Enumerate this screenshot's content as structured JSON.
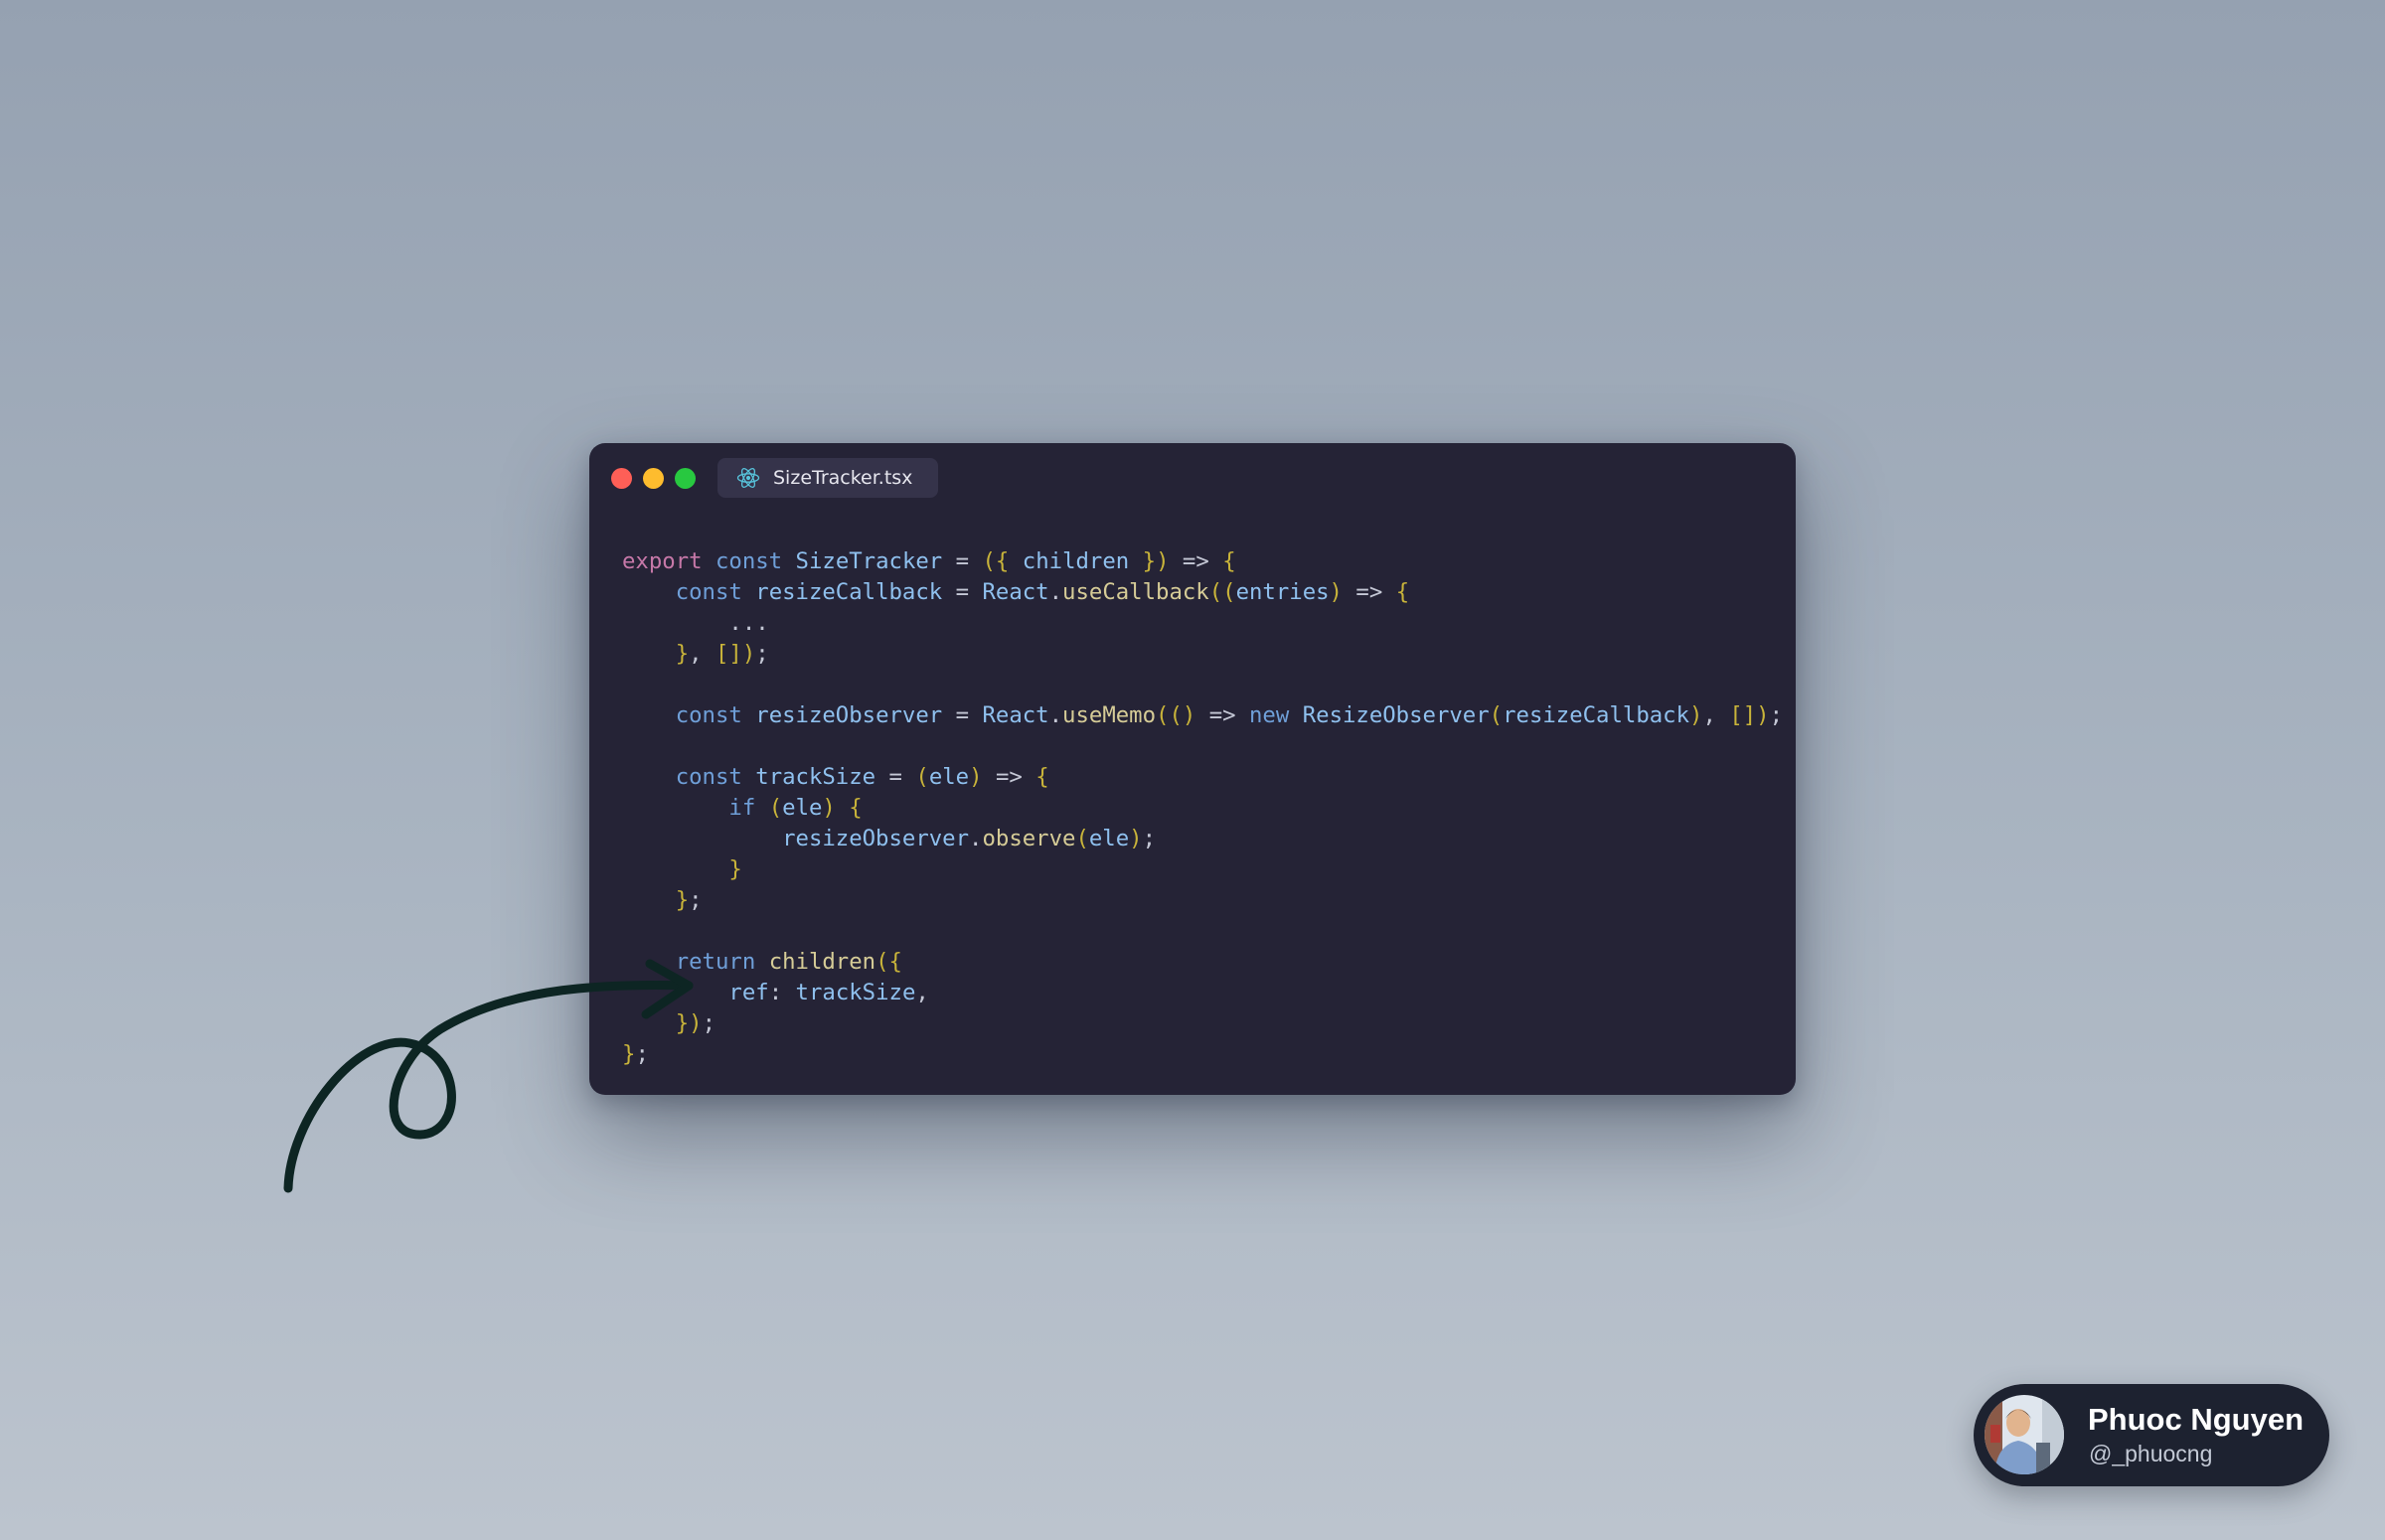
{
  "window": {
    "traffic_lights": {
      "close": "#fe5f57",
      "minimize": "#febc2e",
      "maximize": "#28c840"
    },
    "tab": {
      "icon": "react-icon",
      "icon_color": "#58c4dc",
      "filename": "SizeTracker.tsx"
    },
    "background": "#252336"
  },
  "code": {
    "language": "tsx",
    "lines": [
      [
        [
          "kw-pink",
          "export"
        ],
        [
          "plain",
          " "
        ],
        [
          "kw",
          "const"
        ],
        [
          "plain",
          " "
        ],
        [
          "name",
          "SizeTracker"
        ],
        [
          "op",
          " = "
        ],
        [
          "punc",
          "({"
        ],
        [
          "plain",
          " "
        ],
        [
          "name",
          "children"
        ],
        [
          "plain",
          " "
        ],
        [
          "punc",
          "})"
        ],
        [
          "op",
          " => "
        ],
        [
          "punc",
          "{"
        ]
      ],
      [
        [
          "plain",
          "    "
        ],
        [
          "kw",
          "const"
        ],
        [
          "plain",
          " "
        ],
        [
          "name",
          "resizeCallback"
        ],
        [
          "op",
          " = "
        ],
        [
          "name",
          "React"
        ],
        [
          "op",
          "."
        ],
        [
          "func",
          "useCallback"
        ],
        [
          "punc",
          "(("
        ],
        [
          "name",
          "entries"
        ],
        [
          "punc",
          ")"
        ],
        [
          "op",
          " => "
        ],
        [
          "punc",
          "{"
        ]
      ],
      [
        [
          "plain",
          "        ..."
        ]
      ],
      [
        [
          "plain",
          "    "
        ],
        [
          "punc",
          "}"
        ],
        [
          "op",
          ", "
        ],
        [
          "punc",
          "[])"
        ],
        [
          "op",
          ";"
        ]
      ],
      [],
      [
        [
          "plain",
          "    "
        ],
        [
          "kw",
          "const"
        ],
        [
          "plain",
          " "
        ],
        [
          "name",
          "resizeObserver"
        ],
        [
          "op",
          " = "
        ],
        [
          "name",
          "React"
        ],
        [
          "op",
          "."
        ],
        [
          "func",
          "useMemo"
        ],
        [
          "punc",
          "(()"
        ],
        [
          "op",
          " => "
        ],
        [
          "kw",
          "new"
        ],
        [
          "plain",
          " "
        ],
        [
          "name",
          "ResizeObserver"
        ],
        [
          "punc",
          "("
        ],
        [
          "name",
          "resizeCallback"
        ],
        [
          "punc",
          ")"
        ],
        [
          "op",
          ", "
        ],
        [
          "punc",
          "[])"
        ],
        [
          "op",
          ";"
        ]
      ],
      [],
      [
        [
          "plain",
          "    "
        ],
        [
          "kw",
          "const"
        ],
        [
          "plain",
          " "
        ],
        [
          "name",
          "trackSize"
        ],
        [
          "op",
          " = "
        ],
        [
          "punc",
          "("
        ],
        [
          "name",
          "ele"
        ],
        [
          "punc",
          ")"
        ],
        [
          "op",
          " => "
        ],
        [
          "punc",
          "{"
        ]
      ],
      [
        [
          "plain",
          "        "
        ],
        [
          "kw",
          "if"
        ],
        [
          "plain",
          " "
        ],
        [
          "punc",
          "("
        ],
        [
          "name",
          "ele"
        ],
        [
          "punc",
          ")"
        ],
        [
          "plain",
          " "
        ],
        [
          "punc",
          "{"
        ]
      ],
      [
        [
          "plain",
          "            "
        ],
        [
          "name",
          "resizeObserver"
        ],
        [
          "op",
          "."
        ],
        [
          "func",
          "observe"
        ],
        [
          "punc",
          "("
        ],
        [
          "name",
          "ele"
        ],
        [
          "punc",
          ")"
        ],
        [
          "op",
          ";"
        ]
      ],
      [
        [
          "plain",
          "        "
        ],
        [
          "punc",
          "}"
        ]
      ],
      [
        [
          "plain",
          "    "
        ],
        [
          "punc",
          "}"
        ],
        [
          "op",
          ";"
        ]
      ],
      [],
      [
        [
          "plain",
          "    "
        ],
        [
          "kw",
          "return"
        ],
        [
          "plain",
          " "
        ],
        [
          "func",
          "children"
        ],
        [
          "punc",
          "({"
        ]
      ],
      [
        [
          "plain",
          "        "
        ],
        [
          "name",
          "ref"
        ],
        [
          "op",
          ": "
        ],
        [
          "name",
          "trackSize"
        ],
        [
          "op",
          ","
        ]
      ],
      [
        [
          "plain",
          "    "
        ],
        [
          "punc",
          "})"
        ],
        [
          "op",
          ";"
        ]
      ],
      [
        [
          "punc",
          "}"
        ],
        [
          "op",
          ";"
        ]
      ]
    ]
  },
  "annotation": {
    "type": "hand-drawn-arrow",
    "color": "#0d2523"
  },
  "profile": {
    "name": "Phuoc Nguyen",
    "handle": "@_phuocng"
  }
}
